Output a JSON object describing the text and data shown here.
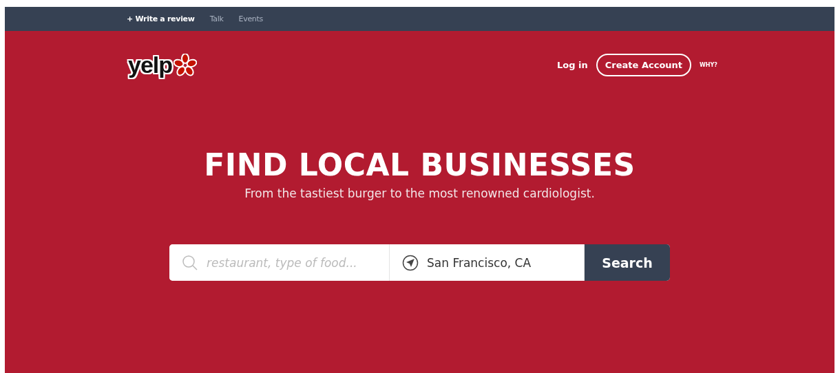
{
  "top_nav": [
    {
      "label": "+ Write a review",
      "selected": true
    },
    {
      "label": "Talk",
      "selected": false
    },
    {
      "label": "Events",
      "selected": false
    }
  ],
  "logo": {
    "text": "yelp"
  },
  "account": {
    "login": "Log in",
    "create": "Create Account",
    "why": "WHY?"
  },
  "hero": {
    "title": "FIND LOCAL BUSINESSES",
    "subtitle": "From the tastiest burger to the most renowned cardiologist."
  },
  "search": {
    "placeholder": "restaurant, type of food...",
    "location": "San Francisco, CA",
    "button": "Search"
  }
}
